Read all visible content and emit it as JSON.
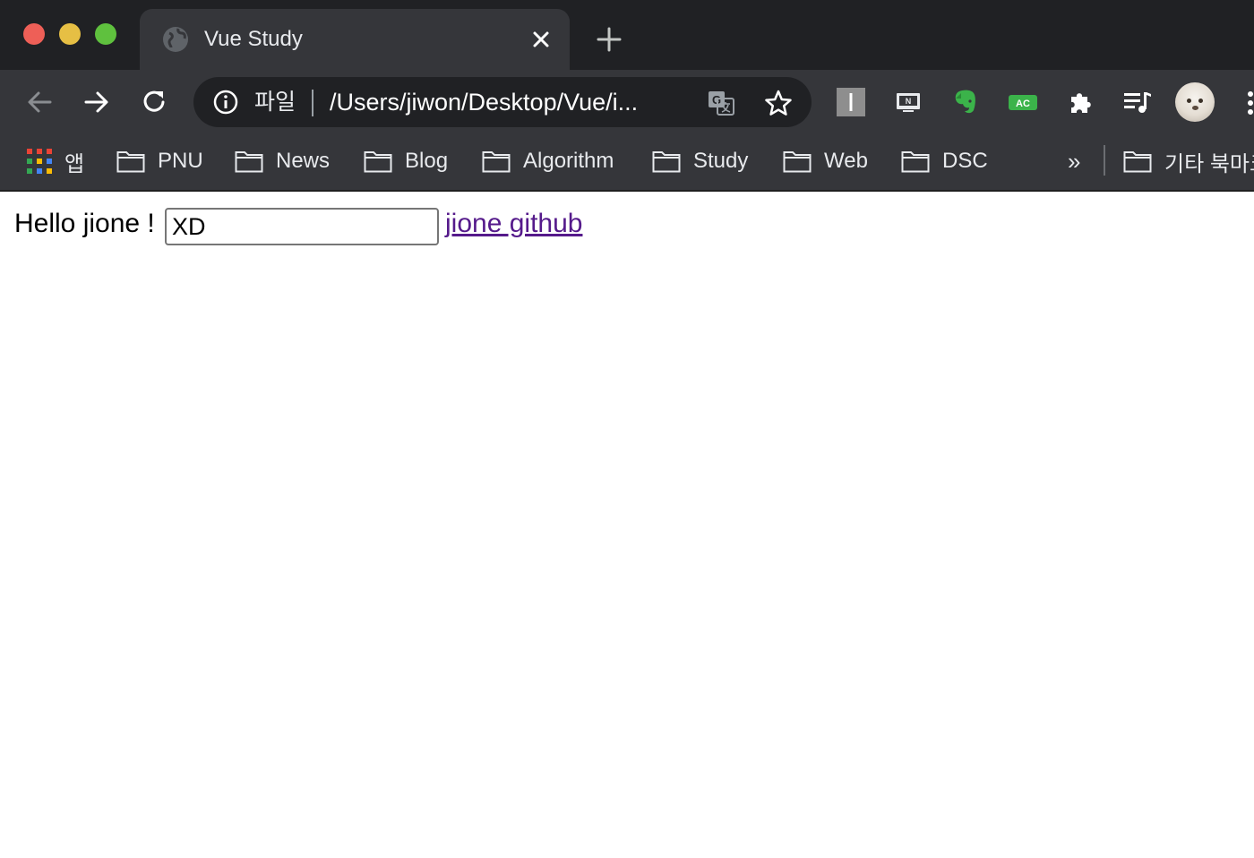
{
  "window": {
    "controls": [
      "close",
      "minimize",
      "maximize"
    ],
    "colors": {
      "close": "#ee5f57",
      "minimize": "#e6bf44",
      "maximize": "#5fc13e"
    }
  },
  "tab": {
    "title": "Vue Study",
    "favicon": "globe-icon"
  },
  "toolbar": {
    "address_scheme": "파일",
    "address_url": "/Users/jiwon/Desktop/Vue/i...",
    "icons": [
      "back-icon",
      "forward-icon",
      "reload-icon",
      "info-icon",
      "translate-icon",
      "star-icon"
    ],
    "extensions": [
      "instapaper-icon",
      "notion-clipper-icon",
      "evernote-icon",
      "ac-extension-icon",
      "puzzle-icon",
      "media-queue-icon"
    ],
    "ac_extension_label": "AC",
    "instapaper_label": "I",
    "notion_label": "N",
    "accent_green": "#3bb34a"
  },
  "bookmarks": {
    "apps_label": "앱",
    "items": [
      "PNU",
      "News",
      "Blog",
      "Algorithm",
      "Study",
      "Web",
      "DSC"
    ],
    "more_label": "»",
    "other_label": "기타 북마크"
  },
  "page": {
    "greeting": "Hello jione !",
    "input_value": "XD",
    "link_text": "jione github",
    "link_color": "#551a8b"
  }
}
